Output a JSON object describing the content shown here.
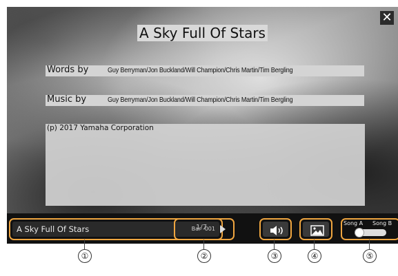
{
  "song": {
    "title": "A Sky Full Of Stars",
    "words_label": "Words by",
    "words_value": "Guy Berryman/Jon Buckland/Will Champion/Chris Martin/Tim Bergling",
    "music_label": "Music by",
    "music_value": "Guy Berryman/Jon Buckland/Will Champion/Chris Martin/Tim Bergling",
    "notes": "(p) 2017 Yamaha Corporation"
  },
  "close": {
    "symbol": "✕",
    "icon": "close-icon"
  },
  "toolbar": {
    "song_name": "A Sky Full Of Stars",
    "bar": "Bar -001",
    "page": "1/7",
    "volume_icon": "speaker-icon",
    "image_icon": "image-icon",
    "song_a": "Song A",
    "song_b": "Song B",
    "accent_color": "#f0a640"
  },
  "callouts": [
    "①",
    "②",
    "③",
    "④",
    "⑤"
  ]
}
